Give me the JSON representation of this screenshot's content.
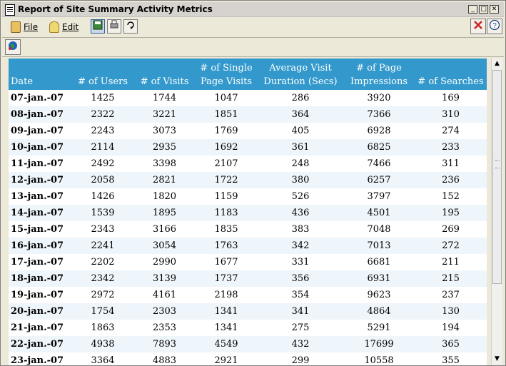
{
  "window": {
    "title": "Report of Site Summary Activity Metrics"
  },
  "menu": {
    "file": "File",
    "edit": "Edit"
  },
  "table": {
    "headers": {
      "date": "Date",
      "users": "# of Users",
      "visits": "# of Visits",
      "single_page_visits_1": "# of Single",
      "single_page_visits_2": "Page Visits",
      "avg_duration_1": "Average Visit",
      "avg_duration_2": "Duration (Secs)",
      "impressions_1": "# of Page",
      "impressions_2": "Impressions",
      "searches": "# of Searches"
    },
    "rows": [
      [
        "07-jan.-07",
        "1425",
        "1744",
        "1047",
        "286",
        "3920",
        "169"
      ],
      [
        "08-jan.-07",
        "2322",
        "3221",
        "1851",
        "364",
        "7366",
        "310"
      ],
      [
        "09-jan.-07",
        "2243",
        "3073",
        "1769",
        "405",
        "6928",
        "274"
      ],
      [
        "10-jan.-07",
        "2114",
        "2935",
        "1692",
        "361",
        "6825",
        "233"
      ],
      [
        "11-jan.-07",
        "2492",
        "3398",
        "2107",
        "248",
        "7466",
        "311"
      ],
      [
        "12-jan.-07",
        "2058",
        "2821",
        "1722",
        "380",
        "6257",
        "236"
      ],
      [
        "13-jan.-07",
        "1426",
        "1820",
        "1159",
        "526",
        "3797",
        "152"
      ],
      [
        "14-jan.-07",
        "1539",
        "1895",
        "1183",
        "436",
        "4501",
        "195"
      ],
      [
        "15-jan.-07",
        "2343",
        "3166",
        "1835",
        "383",
        "7048",
        "269"
      ],
      [
        "16-jan.-07",
        "2241",
        "3054",
        "1763",
        "342",
        "7013",
        "272"
      ],
      [
        "17-jan.-07",
        "2202",
        "2990",
        "1677",
        "331",
        "6681",
        "211"
      ],
      [
        "18-jan.-07",
        "2342",
        "3139",
        "1737",
        "356",
        "6931",
        "215"
      ],
      [
        "19-jan.-07",
        "2972",
        "4161",
        "2198",
        "354",
        "9623",
        "237"
      ],
      [
        "20-jan.-07",
        "1754",
        "2303",
        "1341",
        "341",
        "4864",
        "130"
      ],
      [
        "21-jan.-07",
        "1863",
        "2353",
        "1341",
        "275",
        "5291",
        "194"
      ],
      [
        "22-jan.-07",
        "4938",
        "7893",
        "4549",
        "432",
        "17699",
        "365"
      ],
      [
        "23-jan.-07",
        "3364",
        "4883",
        "2921",
        "299",
        "10558",
        "355"
      ]
    ]
  },
  "colors": {
    "header_bg": "#3399cc",
    "header_text": "#ffffff",
    "row_alt": "#eef5fb"
  },
  "icons": {
    "app": "document-icon",
    "file": "file-icon",
    "edit": "edit-icon",
    "save": "save-icon",
    "print": "print-icon",
    "refresh": "refresh-icon",
    "close": "close-icon",
    "help": "help-icon",
    "globe": "globe-icon"
  }
}
